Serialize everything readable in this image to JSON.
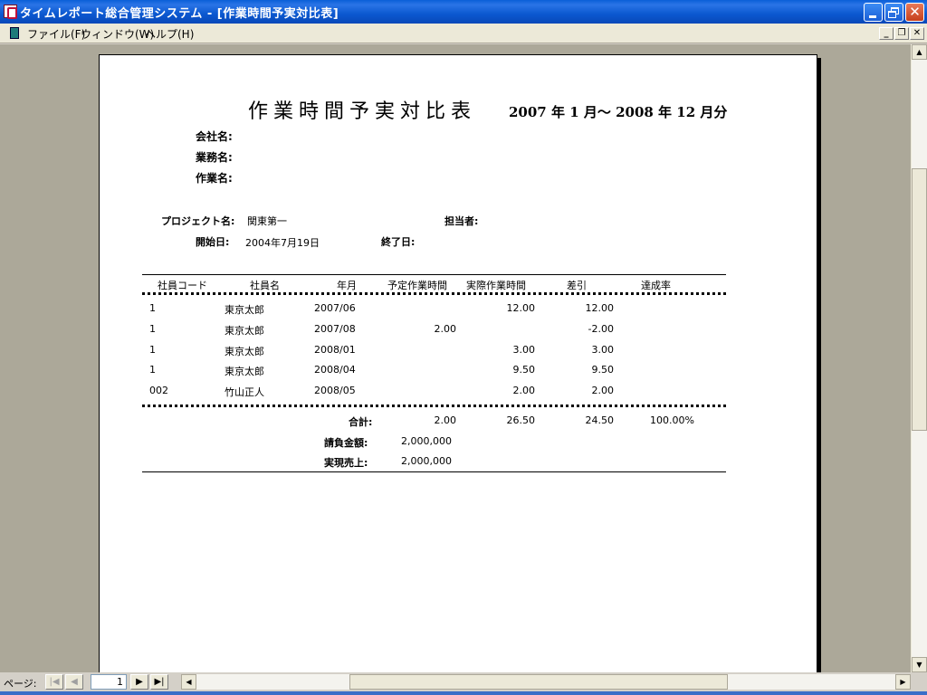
{
  "window": {
    "title": "タイムレポート総合管理システム - [作業時間予実対比表]"
  },
  "menu": {
    "items": [
      "ファイル(F)",
      "ウィンドウ(W)",
      "ヘルプ(H)"
    ]
  },
  "report": {
    "title": "作業時間予実対比表",
    "period": "2007 年  1 月～ 2008 年 12 月分",
    "company_label": "会社名:",
    "business_label": "業務名:",
    "work_label": "作業名:",
    "project_label": "プロジェクト名:",
    "project_value": "関東第一",
    "manager_label": "担当者:",
    "start_label": "開始日:",
    "start_value": "2004年7月19日",
    "end_label": "終了日:",
    "columns": [
      "社員コード",
      "社員名",
      "年月",
      "予定作業時間",
      "実際作業時間",
      "差引",
      "達成率"
    ],
    "rows": [
      {
        "code": "1",
        "name": "東京太郎",
        "ym": "2007/06",
        "planned": "",
        "actual": "12.00",
        "diff": "12.00",
        "rate": ""
      },
      {
        "code": "1",
        "name": "東京太郎",
        "ym": "2007/08",
        "planned": "2.00",
        "actual": "",
        "diff": "-2.00",
        "rate": ""
      },
      {
        "code": "1",
        "name": "東京太郎",
        "ym": "2008/01",
        "planned": "",
        "actual": "3.00",
        "diff": "3.00",
        "rate": ""
      },
      {
        "code": "1",
        "name": "東京太郎",
        "ym": "2008/04",
        "planned": "",
        "actual": "9.50",
        "diff": "9.50",
        "rate": ""
      },
      {
        "code": "002",
        "name": "竹山正人",
        "ym": "2008/05",
        "planned": "",
        "actual": "2.00",
        "diff": "2.00",
        "rate": ""
      }
    ],
    "total_label": "合計:",
    "total_planned": "2.00",
    "total_actual": "26.50",
    "total_diff": "24.50",
    "total_rate": "100.00%",
    "billing_label": "請負金額:",
    "billing_value": "2,000,000",
    "sales_label": "実現売上:",
    "sales_value": "2,000,000"
  },
  "navigation": {
    "page_label": "ページ:",
    "page_number": "1"
  }
}
